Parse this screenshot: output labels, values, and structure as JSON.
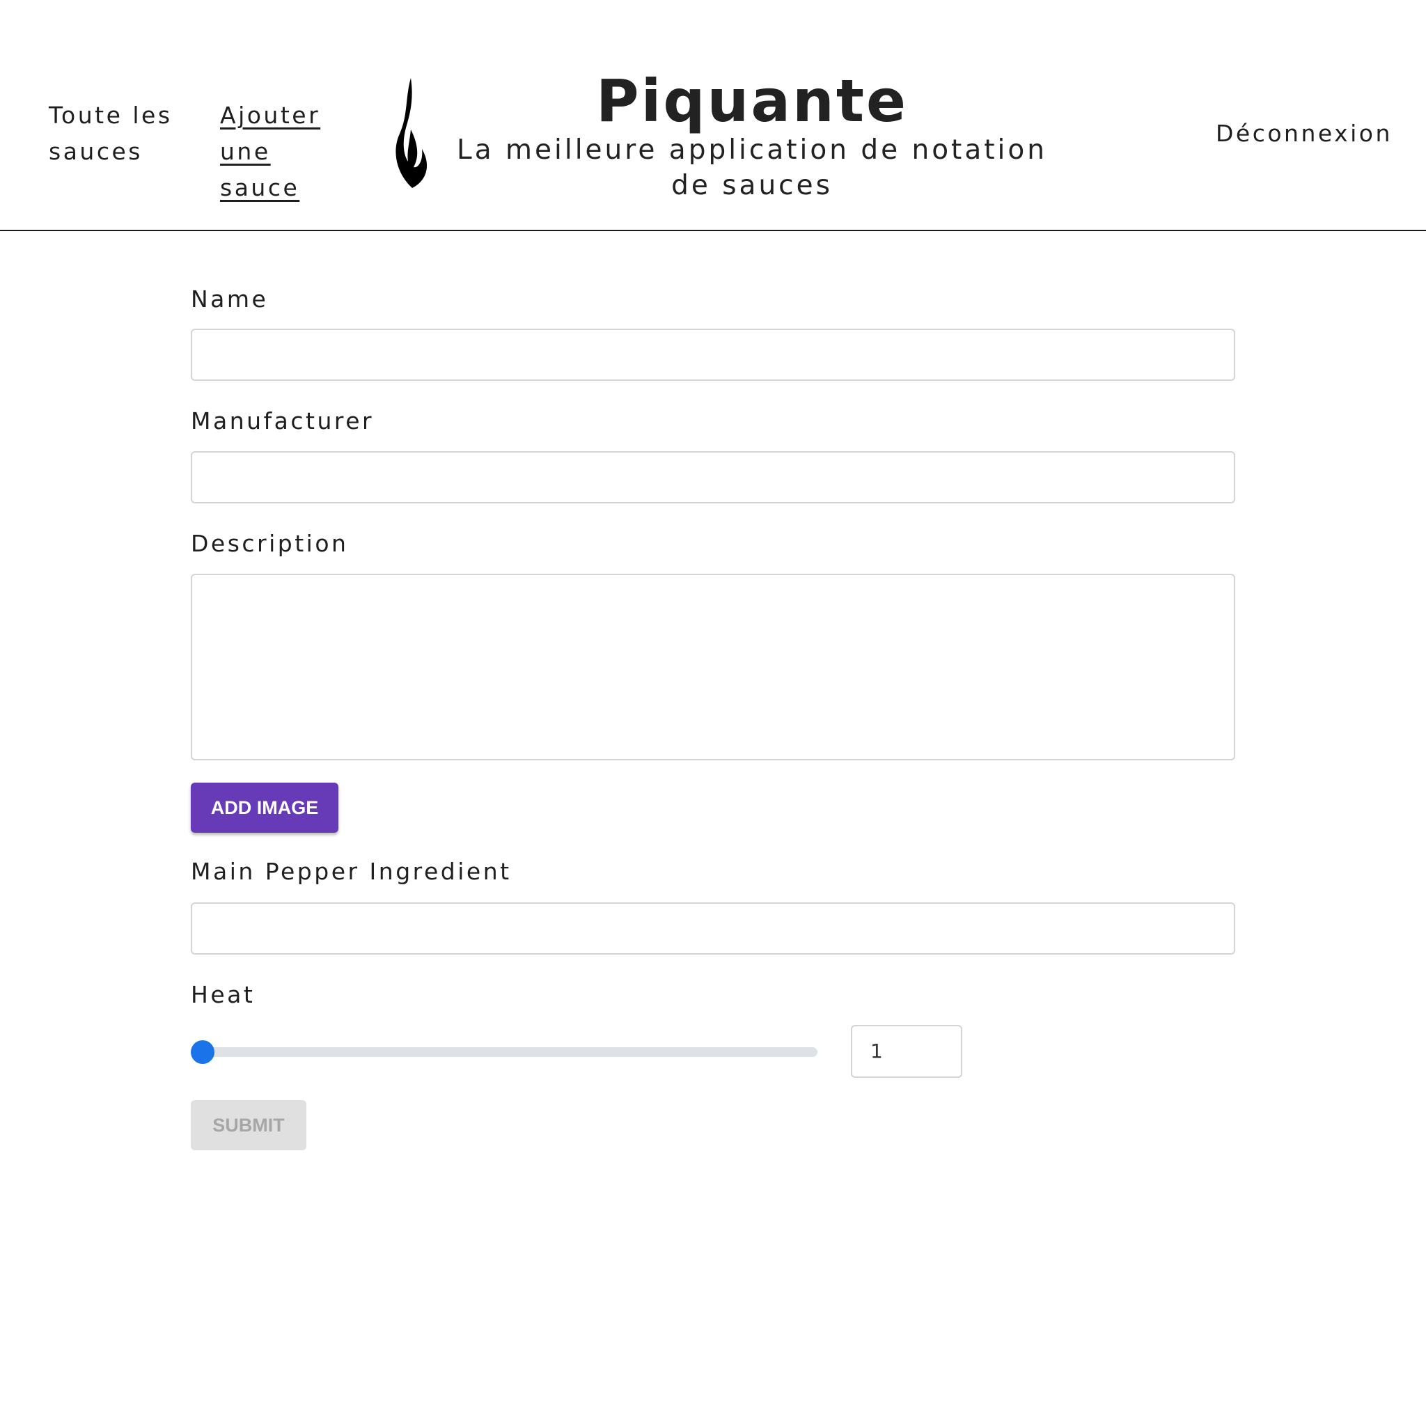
{
  "header": {
    "nav_all_sauces": "Toute les sauces",
    "nav_add_sauce": "Ajouter une sauce",
    "title": "Piquante",
    "subtitle": "La meilleure application de notation de sauces",
    "logout": "Déconnexion",
    "logo_icon": "flame-icon"
  },
  "form": {
    "name_label": "Name",
    "name_value": "",
    "manufacturer_label": "Manufacturer",
    "manufacturer_value": "",
    "description_label": "Description",
    "description_value": "",
    "add_image_label": "ADD IMAGE",
    "pepper_label": "Main Pepper Ingredient",
    "pepper_value": "",
    "heat_label": "Heat",
    "heat_value": "1",
    "heat_min": 1,
    "heat_max": 10,
    "submit_label": "SUBMIT"
  },
  "colors": {
    "primary_button": "#673ab7",
    "slider_thumb": "#1a73e8",
    "slider_track": "#dee1e6",
    "disabled_button": "#e0e0e0"
  }
}
